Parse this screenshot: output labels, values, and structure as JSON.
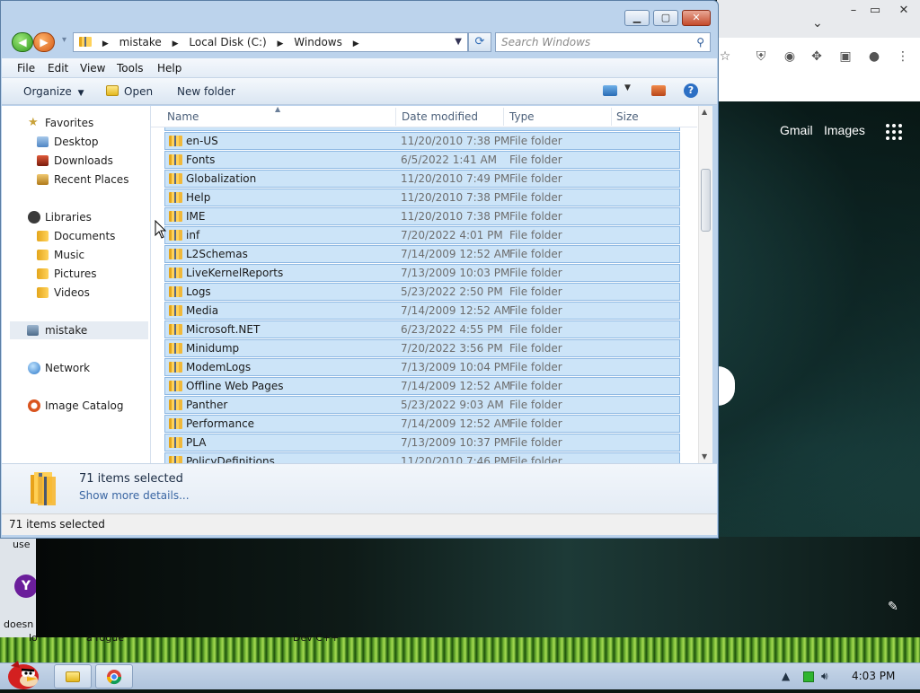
{
  "explorer": {
    "address": {
      "crumbs": [
        "mistake",
        "Local Disk (C:)",
        "Windows"
      ]
    },
    "search_placeholder": "Search Windows",
    "menu": [
      "File",
      "Edit",
      "View",
      "Tools",
      "Help"
    ],
    "commands": {
      "organize": "Organize",
      "open": "Open",
      "new_folder": "New folder"
    },
    "nav": {
      "favorites": "Favorites",
      "desktop": "Desktop",
      "downloads": "Downloads",
      "recent_places": "Recent Places",
      "libraries": "Libraries",
      "documents": "Documents",
      "music": "Music",
      "pictures": "Pictures",
      "videos": "Videos",
      "mistake": "mistake",
      "network": "Network",
      "image_catalog": "Image Catalog"
    },
    "columns": {
      "name": "Name",
      "date_modified": "Date modified",
      "type": "Type",
      "size": "Size"
    },
    "files": [
      {
        "name": "en-US",
        "date": "11/20/2010 7:38 PM",
        "type": "File folder"
      },
      {
        "name": "Fonts",
        "date": "6/5/2022 1:41 AM",
        "type": "File folder"
      },
      {
        "name": "Globalization",
        "date": "11/20/2010 7:49 PM",
        "type": "File folder"
      },
      {
        "name": "Help",
        "date": "11/20/2010 7:38 PM",
        "type": "File folder"
      },
      {
        "name": "IME",
        "date": "11/20/2010 7:38 PM",
        "type": "File folder"
      },
      {
        "name": "inf",
        "date": "7/20/2022 4:01 PM",
        "type": "File folder"
      },
      {
        "name": "L2Schemas",
        "date": "7/14/2009 12:52 AM",
        "type": "File folder"
      },
      {
        "name": "LiveKernelReports",
        "date": "7/13/2009 10:03 PM",
        "type": "File folder"
      },
      {
        "name": "Logs",
        "date": "5/23/2022 2:50 PM",
        "type": "File folder"
      },
      {
        "name": "Media",
        "date": "7/14/2009 12:52 AM",
        "type": "File folder"
      },
      {
        "name": "Microsoft.NET",
        "date": "6/23/2022 4:55 PM",
        "type": "File folder"
      },
      {
        "name": "Minidump",
        "date": "7/20/2022 3:56 PM",
        "type": "File folder"
      },
      {
        "name": "ModemLogs",
        "date": "7/13/2009 10:04 PM",
        "type": "File folder"
      },
      {
        "name": "Offline Web Pages",
        "date": "7/14/2009 12:52 AM",
        "type": "File folder"
      },
      {
        "name": "Panther",
        "date": "5/23/2022 9:03 AM",
        "type": "File folder"
      },
      {
        "name": "Performance",
        "date": "7/14/2009 12:52 AM",
        "type": "File folder"
      },
      {
        "name": "PLA",
        "date": "7/13/2009 10:37 PM",
        "type": "File folder"
      },
      {
        "name": "PolicyDefinitions",
        "date": "11/20/2010 7:46 PM",
        "type": "File folder"
      }
    ],
    "details": {
      "count": "71 items selected",
      "more": "Show more details..."
    },
    "status": "71 items selected"
  },
  "chrome": {
    "gmail": "Gmail",
    "images": "Images"
  },
  "desktop_text": {
    "use": "use",
    "doesn": "doesn",
    "lo": "lo",
    "a_rogue": "a rogue",
    "dev": "Dev C++"
  },
  "taskbar": {
    "time": "4:03 PM"
  },
  "icons": {
    "back": "back-arrow-icon",
    "forward": "forward-arrow-icon",
    "refresh": "refresh-icon",
    "search": "search-icon",
    "help": "help-icon",
    "folder": "folder-icon"
  },
  "colors": {
    "selection": "#cce4f8",
    "selection_border": "#8fb9e3",
    "window_frame": "#bcd3ec",
    "link": "#3a66a3"
  }
}
